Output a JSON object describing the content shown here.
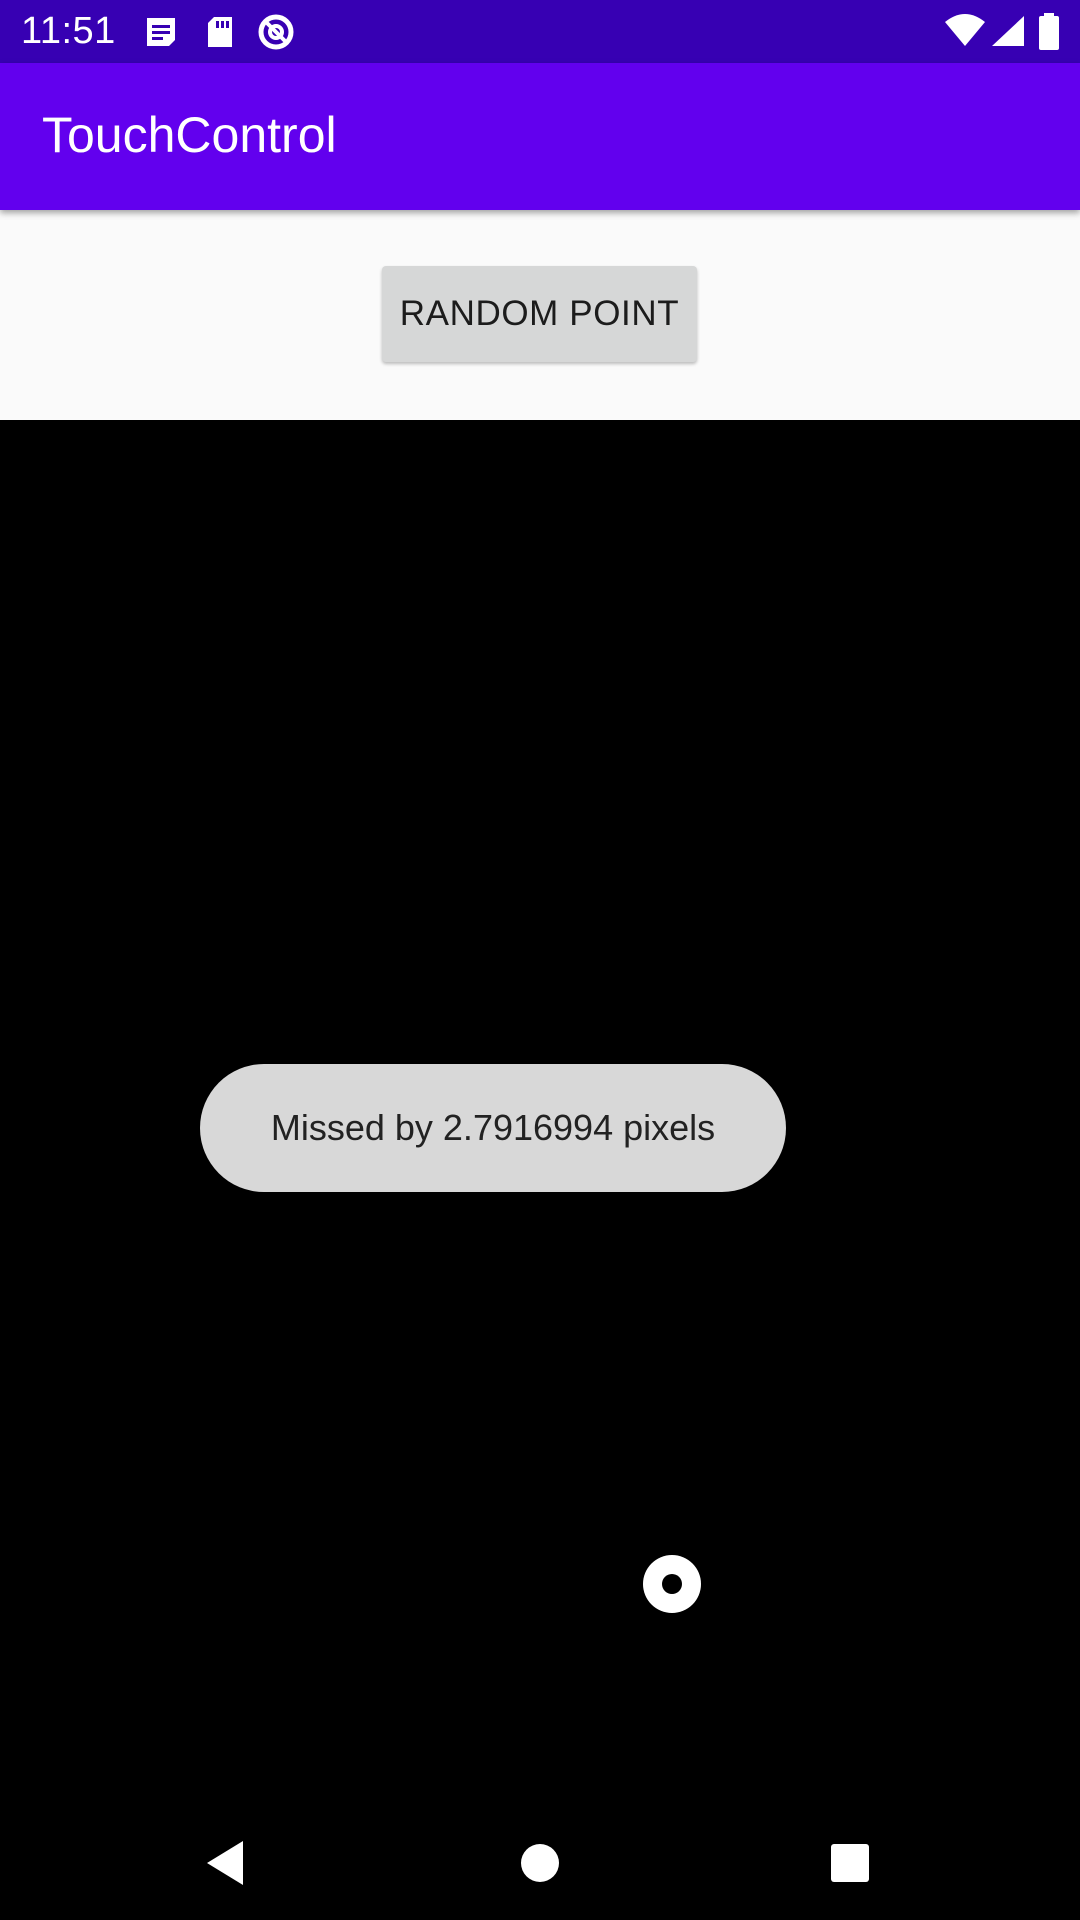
{
  "status_bar": {
    "time": "11:51",
    "background_color": "#3700b3",
    "left_icons": [
      "message-icon",
      "sd-card-icon",
      "data-saver-icon"
    ],
    "right_icons": [
      "wifi-icon",
      "cellular-signal-icon",
      "battery-icon"
    ]
  },
  "app_bar": {
    "title": "TouchControl",
    "background_color": "#6200ee"
  },
  "controls": {
    "random_button_label": "RANDOM POINT"
  },
  "toast": {
    "message": "Missed by 2.7916994 pixels"
  },
  "canvas": {
    "background_color": "#000000",
    "target_icon": "target-point-icon"
  },
  "nav_bar": {
    "buttons": [
      "back-icon",
      "home-icon",
      "recents-icon"
    ]
  }
}
